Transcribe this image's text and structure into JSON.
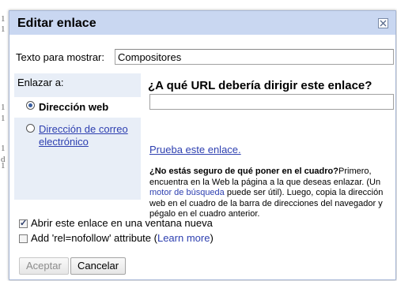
{
  "background": {
    "glyphs": [
      "1",
      "1",
      "1",
      "1",
      "1",
      "d",
      "1"
    ]
  },
  "dialog": {
    "title": "Editar enlace",
    "close_icon": "close-icon"
  },
  "display_text": {
    "label": "Texto para mostrar:",
    "value": "Compositores"
  },
  "link_to": {
    "label": "Enlazar a:",
    "options": [
      {
        "label": "Dirección web",
        "selected": true
      },
      {
        "label": "Dirección de correo electrónico",
        "selected": false
      }
    ]
  },
  "url": {
    "question": "¿A qué URL debería dirigir este enlace?",
    "value": "",
    "test_link": "Prueba este enlace.",
    "help_bold": "¿No estás seguro de qué poner en el cuadro?",
    "help_part1": "Primero, encuentra en la Web la página a la que deseas enlazar. (Un ",
    "help_link": "motor de búsqueda",
    "help_part2": " puede ser útil). Luego, copia la dirección web en el cuadro de la barra de direcciones del navegador y pégalo en el cuadro anterior."
  },
  "options": {
    "new_window": {
      "label": "Abrir este enlace en una ventana nueva",
      "checked": true
    },
    "nofollow": {
      "label_prefix": "Add 'rel=nofollow' attribute (",
      "link": "Learn more",
      "label_suffix": ")",
      "checked": false
    }
  },
  "buttons": {
    "accept": "Aceptar",
    "cancel": "Cancelar"
  },
  "colors": {
    "title_bar": "#c9d7f1",
    "link": "#2d3fb0",
    "panel": "#e8eef7"
  }
}
